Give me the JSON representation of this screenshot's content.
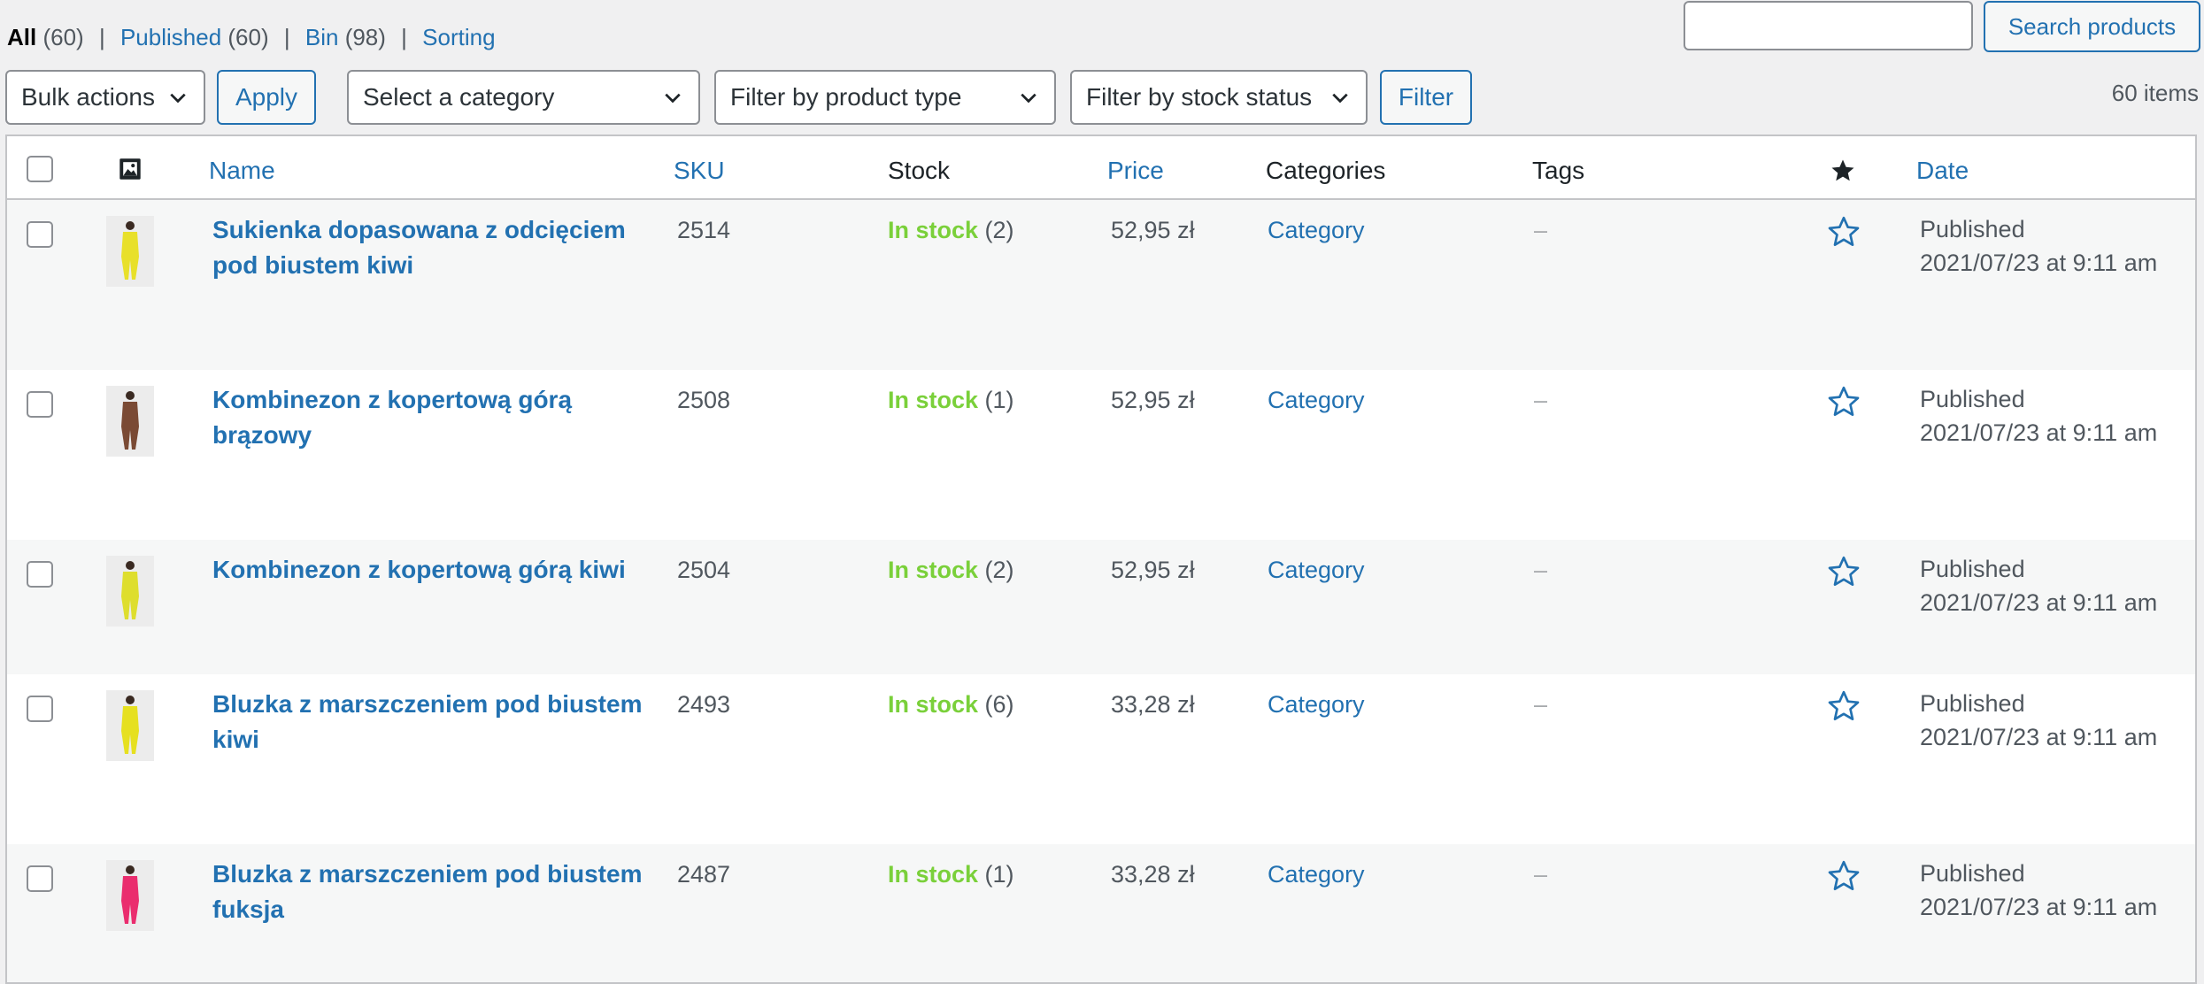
{
  "views": {
    "all_label": "All",
    "all_count": "(60)",
    "published_label": "Published",
    "published_count": "(60)",
    "bin_label": "Bin",
    "bin_count": "(98)",
    "sorting_label": "Sorting",
    "separator": "|"
  },
  "search": {
    "input_value": "",
    "button_label": "Search products"
  },
  "toolbar": {
    "bulk_actions": "Bulk actions",
    "apply": "Apply",
    "category": "Select a category",
    "product_type": "Filter by product type",
    "stock_status": "Filter by stock status",
    "filter": "Filter",
    "items_count": "60 items"
  },
  "columns": {
    "thumb_icon": "image-icon",
    "name": "Name",
    "sku": "SKU",
    "stock": "Stock",
    "price": "Price",
    "categories": "Categories",
    "tags": "Tags",
    "featured_icon": "star-filled-icon",
    "date": "Date"
  },
  "products": [
    {
      "name": "Sukienka dopasowana z odcięciem pod biustem kiwi",
      "sku": "2514",
      "stock_status": "In stock",
      "stock_qty": "(2)",
      "price": "52,95 zł",
      "category": "Category",
      "tags": "–",
      "date_status": "Published",
      "date": "2021/07/23 at 9:11 am",
      "thumb_color": "#e8e02a"
    },
    {
      "name": "Kombinezon z kopertową górą brązowy",
      "sku": "2508",
      "stock_status": "In stock",
      "stock_qty": "(1)",
      "price": "52,95 zł",
      "category": "Category",
      "tags": "–",
      "date_status": "Published",
      "date": "2021/07/23 at 9:11 am",
      "thumb_color": "#7a4a34"
    },
    {
      "name": "Kombinezon z kopertową górą kiwi",
      "sku": "2504",
      "stock_status": "In stock",
      "stock_qty": "(2)",
      "price": "52,95 zł",
      "category": "Category",
      "tags": "–",
      "date_status": "Published",
      "date": "2021/07/23 at 9:11 am",
      "thumb_color": "#dede2e"
    },
    {
      "name": "Bluzka z marszczeniem pod biustem kiwi",
      "sku": "2493",
      "stock_status": "In stock",
      "stock_qty": "(6)",
      "price": "33,28 zł",
      "category": "Category",
      "tags": "–",
      "date_status": "Published",
      "date": "2021/07/23 at 9:11 am",
      "thumb_color": "#e6e020"
    },
    {
      "name": "Bluzka z marszczeniem pod biustem fuksja",
      "sku": "2487",
      "stock_status": "In stock",
      "stock_qty": "(1)",
      "price": "33,28 zł",
      "category": "Category",
      "tags": "–",
      "date_status": "Published",
      "date": "2021/07/23 at 9:11 am",
      "thumb_color": "#ea2d6e"
    }
  ],
  "colors": {
    "accent": "#2271b1",
    "in_stock": "#7ad03a",
    "border": "#c3c4c7",
    "alt_row": "#f6f7f7"
  }
}
